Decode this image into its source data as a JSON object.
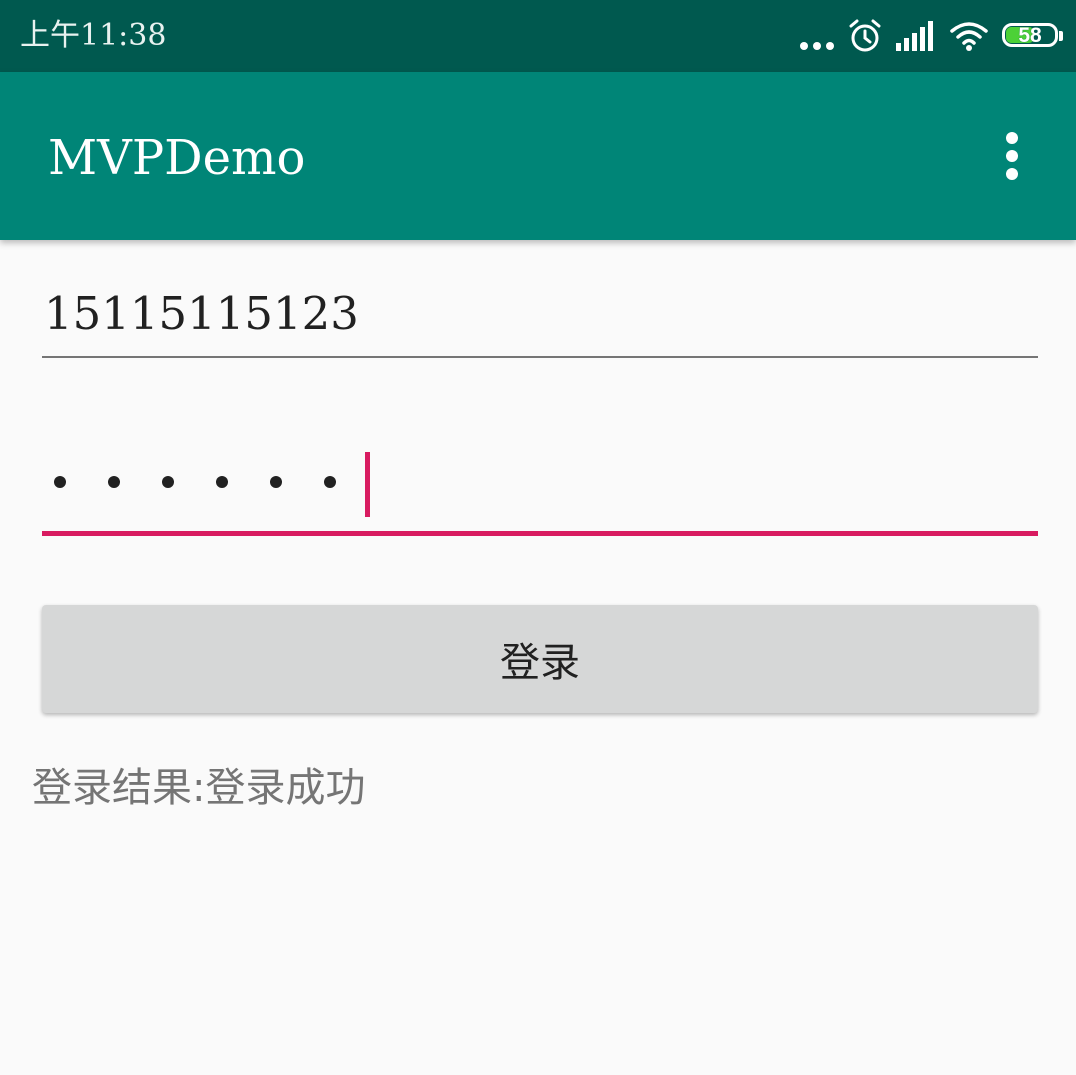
{
  "status_bar": {
    "time": "上午11:38",
    "battery_level": "58",
    "icons": [
      "more-notifications-icon",
      "alarm-clock-icon",
      "signal-icon",
      "wifi-icon",
      "battery-icon"
    ],
    "background_color": "#00594f"
  },
  "app_bar": {
    "title": "MVPDemo",
    "background_color": "#008577",
    "menu_icon": "overflow-menu-icon"
  },
  "form": {
    "username_value": "15115115123",
    "password_masked_length": 6,
    "accent_color": "#d81b60",
    "login_button_label": "登录",
    "result_text": "登录结果:登录成功"
  }
}
